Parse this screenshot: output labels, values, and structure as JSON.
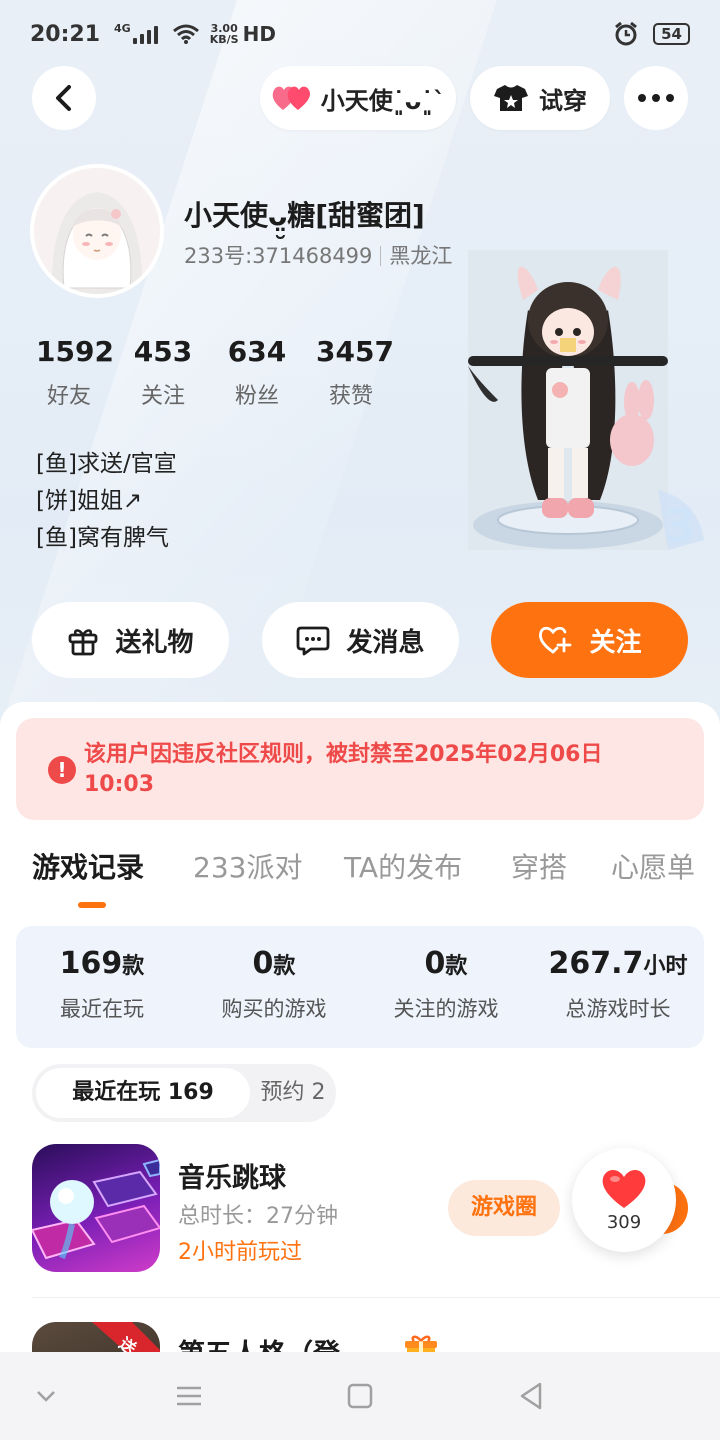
{
  "status_bar": {
    "time": "20:21",
    "network": "4G",
    "speed_top": "3.00",
    "speed_bottom": "KB/S",
    "hd": "HD",
    "battery": "54"
  },
  "header": {
    "companion_name": "小天使˙͈ᴗ˙͈`",
    "try_on_label": "试穿"
  },
  "profile": {
    "name": "小天使ᴗ̤̮糖[甜蜜团]",
    "id_text": "233号:371468499",
    "location": "黑龙江",
    "stats": [
      {
        "value": "1592",
        "label": "好友"
      },
      {
        "value": "453",
        "label": "关注"
      },
      {
        "value": "634",
        "label": "粉丝"
      },
      {
        "value": "3457",
        "label": "获赞"
      }
    ],
    "bio": [
      "[鱼]求送/官宣",
      "[饼]姐姐↗",
      "[鱼]窝有脾气"
    ]
  },
  "actions": {
    "gift": "送礼物",
    "message": "发消息",
    "follow": "关注"
  },
  "ban_notice": "该用户因违反社区规则，被封禁至2025年02月06日 10:03",
  "tabs": [
    "游戏记录",
    "233派对",
    "TA的发布",
    "穿搭",
    "心愿单"
  ],
  "active_tab": 0,
  "summary": [
    {
      "value": "169",
      "unit": "款",
      "label": "最近在玩"
    },
    {
      "value": "0",
      "unit": "款",
      "label": "购买的游戏"
    },
    {
      "value": "0",
      "unit": "款",
      "label": "关注的游戏"
    },
    {
      "value": "267.7",
      "unit": "小时",
      "label": "总游戏时长"
    }
  ],
  "segment": {
    "recent": "最近在玩 169",
    "reserve": "预约 2"
  },
  "games": [
    {
      "title": "音乐跳球",
      "duration": "总时长：27分钟",
      "last_played": "2小时前玩过",
      "circle_btn": "游戏圈"
    },
    {
      "title": "第五人格（登",
      "badge": "送"
    }
  ],
  "like_count": "309",
  "colors": {
    "accent": "#ff7210",
    "warning": "#ef4a4a",
    "banner_bg": "#fde6e3"
  }
}
